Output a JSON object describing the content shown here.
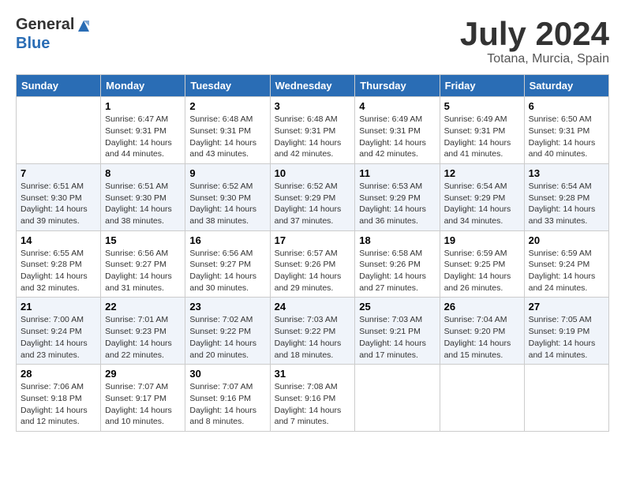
{
  "header": {
    "logo_general": "General",
    "logo_blue": "Blue",
    "month": "July 2024",
    "location": "Totana, Murcia, Spain"
  },
  "weekdays": [
    "Sunday",
    "Monday",
    "Tuesday",
    "Wednesday",
    "Thursday",
    "Friday",
    "Saturday"
  ],
  "weeks": [
    [
      {
        "day": "",
        "sunrise": "",
        "sunset": "",
        "daylight": ""
      },
      {
        "day": "1",
        "sunrise": "Sunrise: 6:47 AM",
        "sunset": "Sunset: 9:31 PM",
        "daylight": "Daylight: 14 hours and 44 minutes."
      },
      {
        "day": "2",
        "sunrise": "Sunrise: 6:48 AM",
        "sunset": "Sunset: 9:31 PM",
        "daylight": "Daylight: 14 hours and 43 minutes."
      },
      {
        "day": "3",
        "sunrise": "Sunrise: 6:48 AM",
        "sunset": "Sunset: 9:31 PM",
        "daylight": "Daylight: 14 hours and 42 minutes."
      },
      {
        "day": "4",
        "sunrise": "Sunrise: 6:49 AM",
        "sunset": "Sunset: 9:31 PM",
        "daylight": "Daylight: 14 hours and 42 minutes."
      },
      {
        "day": "5",
        "sunrise": "Sunrise: 6:49 AM",
        "sunset": "Sunset: 9:31 PM",
        "daylight": "Daylight: 14 hours and 41 minutes."
      },
      {
        "day": "6",
        "sunrise": "Sunrise: 6:50 AM",
        "sunset": "Sunset: 9:31 PM",
        "daylight": "Daylight: 14 hours and 40 minutes."
      }
    ],
    [
      {
        "day": "7",
        "sunrise": "Sunrise: 6:51 AM",
        "sunset": "Sunset: 9:30 PM",
        "daylight": "Daylight: 14 hours and 39 minutes."
      },
      {
        "day": "8",
        "sunrise": "Sunrise: 6:51 AM",
        "sunset": "Sunset: 9:30 PM",
        "daylight": "Daylight: 14 hours and 38 minutes."
      },
      {
        "day": "9",
        "sunrise": "Sunrise: 6:52 AM",
        "sunset": "Sunset: 9:30 PM",
        "daylight": "Daylight: 14 hours and 38 minutes."
      },
      {
        "day": "10",
        "sunrise": "Sunrise: 6:52 AM",
        "sunset": "Sunset: 9:29 PM",
        "daylight": "Daylight: 14 hours and 37 minutes."
      },
      {
        "day": "11",
        "sunrise": "Sunrise: 6:53 AM",
        "sunset": "Sunset: 9:29 PM",
        "daylight": "Daylight: 14 hours and 36 minutes."
      },
      {
        "day": "12",
        "sunrise": "Sunrise: 6:54 AM",
        "sunset": "Sunset: 9:29 PM",
        "daylight": "Daylight: 14 hours and 34 minutes."
      },
      {
        "day": "13",
        "sunrise": "Sunrise: 6:54 AM",
        "sunset": "Sunset: 9:28 PM",
        "daylight": "Daylight: 14 hours and 33 minutes."
      }
    ],
    [
      {
        "day": "14",
        "sunrise": "Sunrise: 6:55 AM",
        "sunset": "Sunset: 9:28 PM",
        "daylight": "Daylight: 14 hours and 32 minutes."
      },
      {
        "day": "15",
        "sunrise": "Sunrise: 6:56 AM",
        "sunset": "Sunset: 9:27 PM",
        "daylight": "Daylight: 14 hours and 31 minutes."
      },
      {
        "day": "16",
        "sunrise": "Sunrise: 6:56 AM",
        "sunset": "Sunset: 9:27 PM",
        "daylight": "Daylight: 14 hours and 30 minutes."
      },
      {
        "day": "17",
        "sunrise": "Sunrise: 6:57 AM",
        "sunset": "Sunset: 9:26 PM",
        "daylight": "Daylight: 14 hours and 29 minutes."
      },
      {
        "day": "18",
        "sunrise": "Sunrise: 6:58 AM",
        "sunset": "Sunset: 9:26 PM",
        "daylight": "Daylight: 14 hours and 27 minutes."
      },
      {
        "day": "19",
        "sunrise": "Sunrise: 6:59 AM",
        "sunset": "Sunset: 9:25 PM",
        "daylight": "Daylight: 14 hours and 26 minutes."
      },
      {
        "day": "20",
        "sunrise": "Sunrise: 6:59 AM",
        "sunset": "Sunset: 9:24 PM",
        "daylight": "Daylight: 14 hours and 24 minutes."
      }
    ],
    [
      {
        "day": "21",
        "sunrise": "Sunrise: 7:00 AM",
        "sunset": "Sunset: 9:24 PM",
        "daylight": "Daylight: 14 hours and 23 minutes."
      },
      {
        "day": "22",
        "sunrise": "Sunrise: 7:01 AM",
        "sunset": "Sunset: 9:23 PM",
        "daylight": "Daylight: 14 hours and 22 minutes."
      },
      {
        "day": "23",
        "sunrise": "Sunrise: 7:02 AM",
        "sunset": "Sunset: 9:22 PM",
        "daylight": "Daylight: 14 hours and 20 minutes."
      },
      {
        "day": "24",
        "sunrise": "Sunrise: 7:03 AM",
        "sunset": "Sunset: 9:22 PM",
        "daylight": "Daylight: 14 hours and 18 minutes."
      },
      {
        "day": "25",
        "sunrise": "Sunrise: 7:03 AM",
        "sunset": "Sunset: 9:21 PM",
        "daylight": "Daylight: 14 hours and 17 minutes."
      },
      {
        "day": "26",
        "sunrise": "Sunrise: 7:04 AM",
        "sunset": "Sunset: 9:20 PM",
        "daylight": "Daylight: 14 hours and 15 minutes."
      },
      {
        "day": "27",
        "sunrise": "Sunrise: 7:05 AM",
        "sunset": "Sunset: 9:19 PM",
        "daylight": "Daylight: 14 hours and 14 minutes."
      }
    ],
    [
      {
        "day": "28",
        "sunrise": "Sunrise: 7:06 AM",
        "sunset": "Sunset: 9:18 PM",
        "daylight": "Daylight: 14 hours and 12 minutes."
      },
      {
        "day": "29",
        "sunrise": "Sunrise: 7:07 AM",
        "sunset": "Sunset: 9:17 PM",
        "daylight": "Daylight: 14 hours and 10 minutes."
      },
      {
        "day": "30",
        "sunrise": "Sunrise: 7:07 AM",
        "sunset": "Sunset: 9:16 PM",
        "daylight": "Daylight: 14 hours and 8 minutes."
      },
      {
        "day": "31",
        "sunrise": "Sunrise: 7:08 AM",
        "sunset": "Sunset: 9:16 PM",
        "daylight": "Daylight: 14 hours and 7 minutes."
      },
      {
        "day": "",
        "sunrise": "",
        "sunset": "",
        "daylight": ""
      },
      {
        "day": "",
        "sunrise": "",
        "sunset": "",
        "daylight": ""
      },
      {
        "day": "",
        "sunrise": "",
        "sunset": "",
        "daylight": ""
      }
    ]
  ]
}
